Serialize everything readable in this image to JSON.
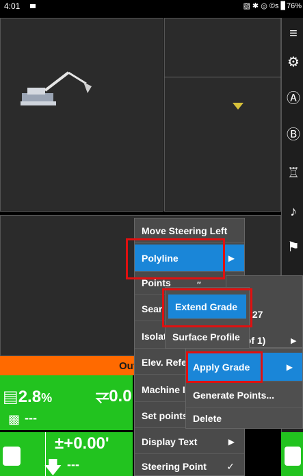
{
  "status": {
    "time": "4:01",
    "right_icons": "▧ ✱ ◎ ©s ▊76%"
  },
  "viewport": {
    "dot_label": "″"
  },
  "orange_bar": {
    "label": "Out"
  },
  "indicators": {
    "slope": "2.8",
    "slope_unit": "%",
    "cross": "⥩0.0",
    "dash_top": "---",
    "elevation": "±+0.00'",
    "dash_bottom": "---"
  },
  "right_toolbar": [
    {
      "icon": "menu-icon",
      "glyph": "≡"
    },
    {
      "icon": "camera-rotate-icon",
      "glyph": "⚙"
    },
    {
      "icon": "lock-icon",
      "glyph": "Ⓐ"
    },
    {
      "icon": "next-icon",
      "glyph": "Ⓑ"
    },
    {
      "icon": "machine-icon",
      "glyph": "♖"
    },
    {
      "icon": "mute-icon",
      "glyph": "♪"
    },
    {
      "icon": "user-location-icon",
      "glyph": "⚑"
    }
  ],
  "menu_main": {
    "items": [
      {
        "label": "Move Steering Left"
      },
      {
        "label": "Polyline",
        "arrow": "▶"
      },
      {
        "label": "Points"
      },
      {
        "label": "Sear"
      },
      {
        "label": "Isolat"
      },
      {
        "label": "Elev. Refe"
      },
      {
        "label": "Machine In"
      },
      {
        "label": "Set points"
      },
      {
        "label": "Display Text",
        "arrow": "▶"
      },
      {
        "label": "Steering Point",
        "check": "✓"
      }
    ]
  },
  "menu_grade": {
    "items": [
      {
        "label": "Extend Grade"
      },
      {
        "label": "Surface Profile"
      }
    ],
    "peek_27": ".27",
    "peek_of": "l of 1)",
    "peek_arrow": "▶"
  },
  "menu_polyline": {
    "items": [
      {
        "label": "Apply Grade",
        "arrow": "▶"
      },
      {
        "label": "Generate Points..."
      },
      {
        "label": "Delete"
      }
    ]
  }
}
